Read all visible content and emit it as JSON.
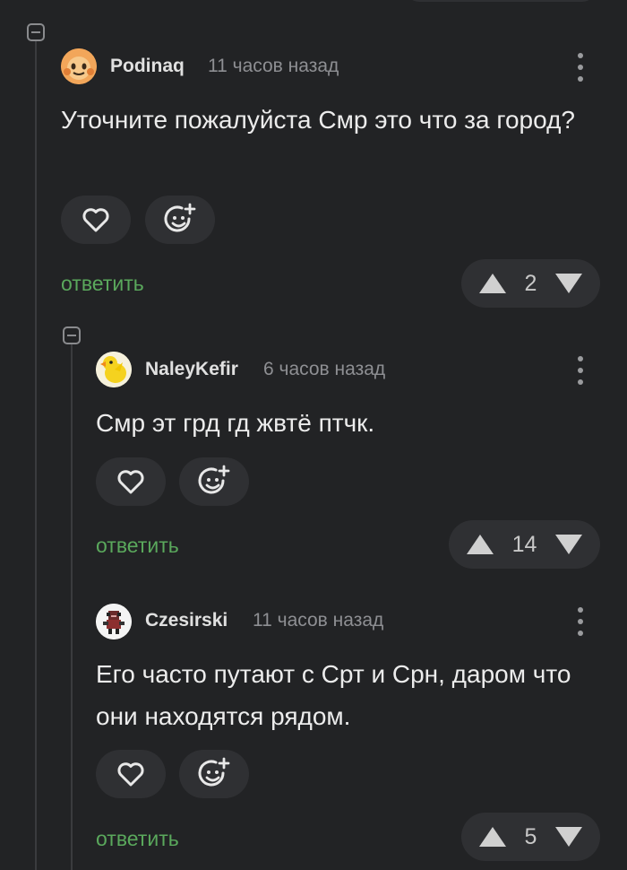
{
  "comments": [
    {
      "author": "Podinaq",
      "time": "11 часов назад",
      "text": "Уточните пожалуйста Смр это что за город?",
      "reply_label": "ответить",
      "rating": "2",
      "avatar": "orange-face-avatar"
    },
    {
      "author": "NaleyKefir",
      "time": "6 часов назад",
      "text": "Смр эт грд гд жвтё птчк.",
      "reply_label": "ответить",
      "rating": "14",
      "avatar": "yellow-duck-avatar"
    },
    {
      "author": "Czesirski",
      "time": "11 часов назад",
      "text": "Его часто путают с Срт и Срн, даром что они находятся рядом.",
      "reply_label": "ответить",
      "rating": "5",
      "avatar": "pixel-character-avatar"
    }
  ],
  "icons": {
    "like": "heart-icon",
    "reaction": "add-emoji-icon",
    "upvote": "arrow-up-icon",
    "downvote": "arrow-down-icon",
    "menu": "more-vertical-icon",
    "collapse": "collapse-thread-icon"
  },
  "colors": {
    "background": "#222325",
    "pill": "#2f3033",
    "reply": "#5aa85c",
    "meta": "#8e8f93"
  }
}
